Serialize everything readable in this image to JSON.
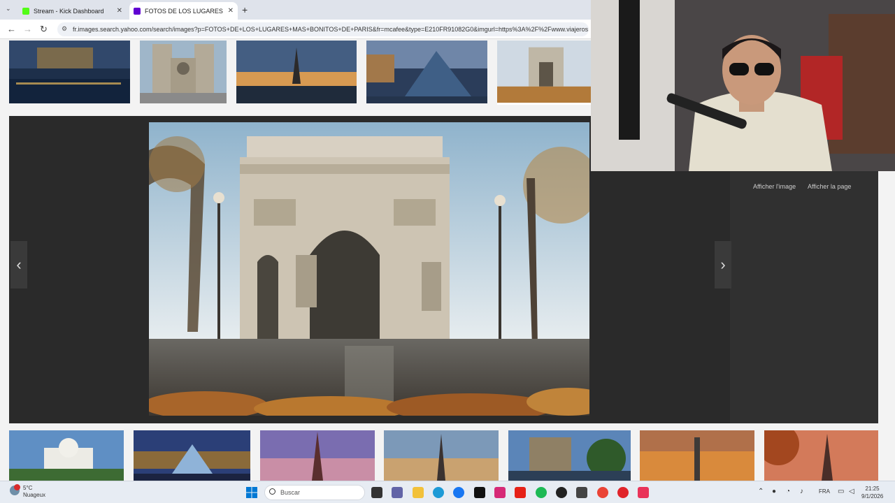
{
  "browser": {
    "tabs": [
      {
        "label": "Stream - Kick Dashboard",
        "active": false,
        "favicon_color": "#53fc18"
      },
      {
        "label": "FOTOS DE LOS LUGARES MAS",
        "active": true,
        "favicon_color": "#6001d2"
      }
    ],
    "new_tab_label": "+",
    "url": "fr.images.search.yahoo.com/search/images?p=FOTOS+DE+LOS+LUGARES+MAS+BONITOS+DE+PARIS&fr=mcafee&type=E210FR91082G0&imgurl=https%3A%2F%2Fwww.viajeros"
  },
  "viewer": {
    "view_image_label": "Afficher l'image",
    "view_page_label": "Afficher la page",
    "prev_symbol": "‹",
    "next_symbol": "›"
  },
  "taskbar": {
    "weather_temp": "5°C",
    "weather_desc": "Nuageux",
    "search_placeholder": "Buscar",
    "language": "FRA",
    "time": "21:25",
    "date": "9/1/2026"
  },
  "colors": {
    "viewer_bg": "#2a2a2a",
    "side_panel": "#303030",
    "accent_windows": "#0078d4"
  }
}
